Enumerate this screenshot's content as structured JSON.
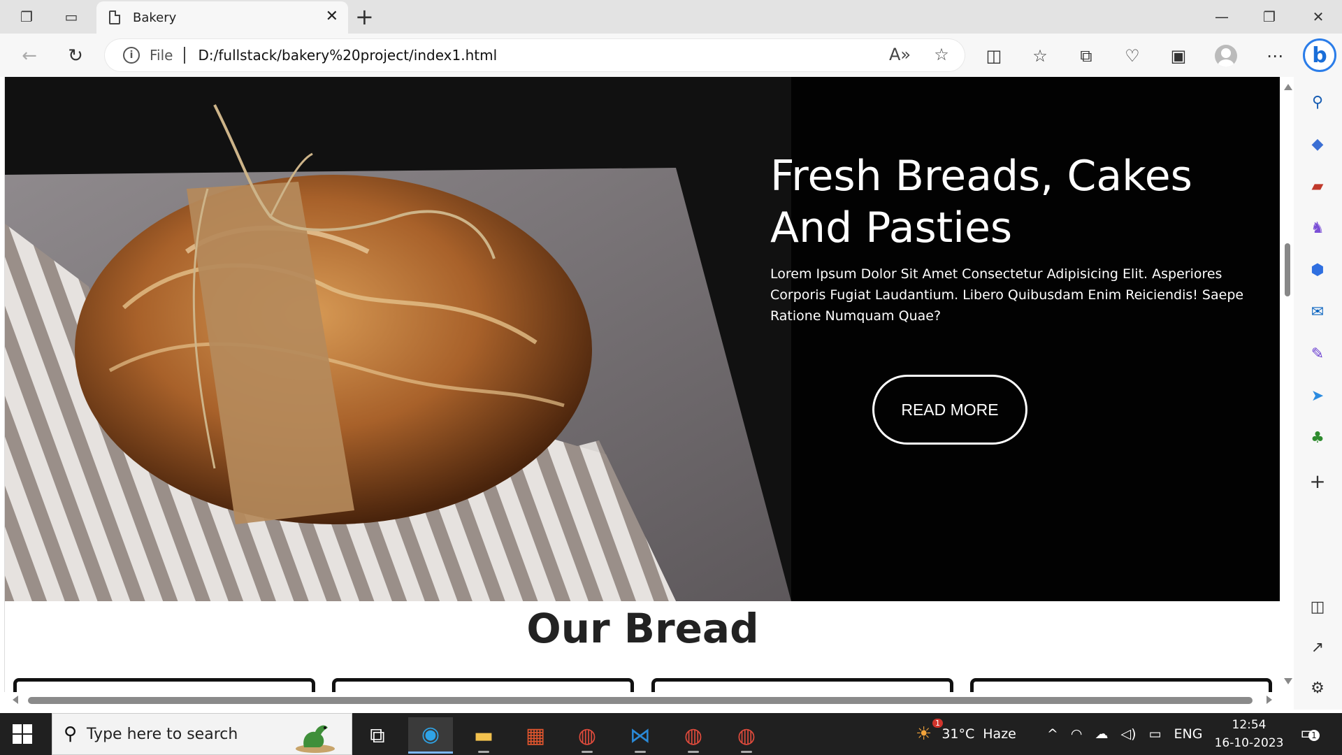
{
  "browser": {
    "tab_title": "Bakery",
    "address_prefix": "File",
    "url": "D:/fullstack/bakery%20project/index1.html"
  },
  "hero": {
    "title": "Fresh Breads, Cakes And Pasties",
    "description": "Lorem Ipsum Dolor Sit Amet Consectetur Adipisicing Elit. Asperiores Corporis Fugiat Laudantium. Libero Quibusdam Enim Reiciendis! Saepe Ratione Numquam Quae?",
    "button_label": "READ MORE"
  },
  "section": {
    "title": "Our Bread"
  },
  "taskbar": {
    "search_placeholder": "Type here to search",
    "weather_temp": "31°C",
    "weather_desc": "Haze",
    "weather_badge": "1",
    "language": "ENG",
    "time": "12:54",
    "date": "16-10-2023",
    "notification_count": "1"
  }
}
